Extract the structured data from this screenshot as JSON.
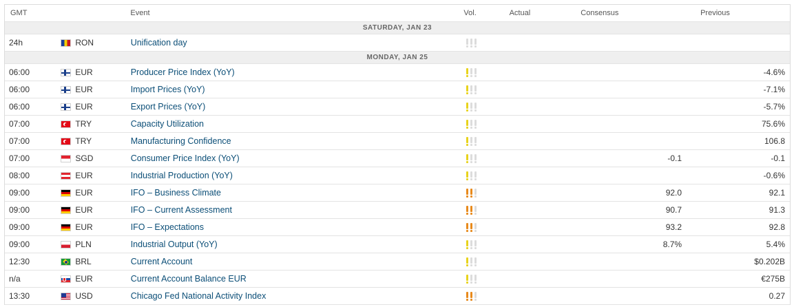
{
  "header": {
    "time": "GMT",
    "event": "Event",
    "vol": "Vol.",
    "actual": "Actual",
    "consensus": "Consensus",
    "previous": "Previous"
  },
  "groups": [
    {
      "day": "SATURDAY, JAN 23",
      "rows": [
        {
          "time": "24h",
          "flag": "ro",
          "currency": "RON",
          "event": "Unification day",
          "vol": 0,
          "actual": "",
          "consensus": "",
          "previous": ""
        }
      ]
    },
    {
      "day": "MONDAY, JAN 25",
      "rows": [
        {
          "time": "06:00",
          "flag": "fi",
          "currency": "EUR",
          "event": "Producer Price Index (YoY)",
          "vol": 1,
          "actual": "",
          "consensus": "",
          "previous": "-4.6%"
        },
        {
          "time": "06:00",
          "flag": "fi",
          "currency": "EUR",
          "event": "Import Prices (YoY)",
          "vol": 1,
          "actual": "",
          "consensus": "",
          "previous": "-7.1%"
        },
        {
          "time": "06:00",
          "flag": "fi",
          "currency": "EUR",
          "event": "Export Prices (YoY)",
          "vol": 1,
          "actual": "",
          "consensus": "",
          "previous": "-5.7%"
        },
        {
          "time": "07:00",
          "flag": "tr",
          "currency": "TRY",
          "event": "Capacity Utilization",
          "vol": 1,
          "actual": "",
          "consensus": "",
          "previous": "75.6%"
        },
        {
          "time": "07:00",
          "flag": "tr",
          "currency": "TRY",
          "event": "Manufacturing Confidence",
          "vol": 1,
          "actual": "",
          "consensus": "",
          "previous": "106.8"
        },
        {
          "time": "07:00",
          "flag": "sg",
          "currency": "SGD",
          "event": "Consumer Price Index (YoY)",
          "vol": 1,
          "actual": "",
          "consensus": "-0.1",
          "previous": "-0.1"
        },
        {
          "time": "08:00",
          "flag": "at",
          "currency": "EUR",
          "event": "Industrial Production (YoY)",
          "vol": 1,
          "actual": "",
          "consensus": "",
          "previous": "-0.6%"
        },
        {
          "time": "09:00",
          "flag": "de",
          "currency": "EUR",
          "event": "IFO – Business Climate",
          "vol": 2,
          "actual": "",
          "consensus": "92.0",
          "previous": "92.1"
        },
        {
          "time": "09:00",
          "flag": "de",
          "currency": "EUR",
          "event": "IFO – Current Assessment",
          "vol": 2,
          "actual": "",
          "consensus": "90.7",
          "previous": "91.3"
        },
        {
          "time": "09:00",
          "flag": "de",
          "currency": "EUR",
          "event": "IFO – Expectations",
          "vol": 2,
          "actual": "",
          "consensus": "93.2",
          "previous": "92.8"
        },
        {
          "time": "09:00",
          "flag": "pl",
          "currency": "PLN",
          "event": "Industrial Output (YoY)",
          "vol": 1,
          "actual": "",
          "consensus": "8.7%",
          "previous": "5.4%"
        },
        {
          "time": "12:30",
          "flag": "br",
          "currency": "BRL",
          "event": "Current Account",
          "vol": 1,
          "actual": "",
          "consensus": "",
          "previous": "$0.202B"
        },
        {
          "time": "n/a",
          "flag": "sk",
          "currency": "EUR",
          "event": "Current Account Balance EUR",
          "vol": 1,
          "actual": "",
          "consensus": "",
          "previous": "€275B"
        },
        {
          "time": "13:30",
          "flag": "us",
          "currency": "USD",
          "event": "Chicago Fed National Activity Index",
          "vol": 2,
          "actual": "",
          "consensus": "",
          "previous": "0.27"
        }
      ]
    }
  ]
}
